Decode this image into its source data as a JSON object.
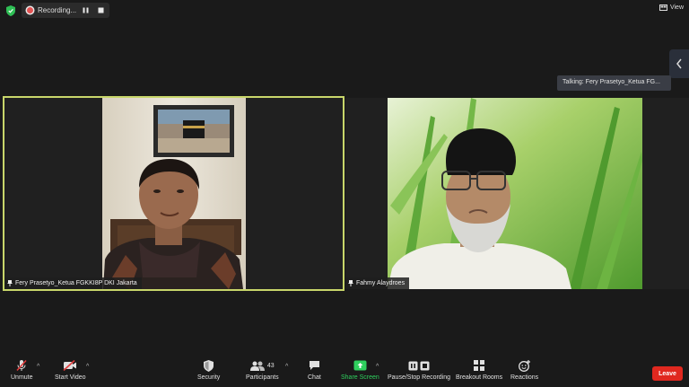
{
  "top": {
    "recording_label": "Recording...",
    "view_label": "View"
  },
  "talking": {
    "text": "Talking: Fery Prasetyo_Ketua FG..."
  },
  "participants_video": [
    {
      "name": "Fery Prasetyo_Ketua FGKKI8P DKI Jakarta",
      "active_speaker": true
    },
    {
      "name": "Fahmy Alaydroes",
      "active_speaker": false
    }
  ],
  "toolbar": {
    "unmute_label": "Unmute",
    "start_video_label": "Start Video",
    "security_label": "Security",
    "participants_label": "Participants",
    "participants_count": "43",
    "chat_label": "Chat",
    "share_screen_label": "Share Screen",
    "pause_stop_recording_label": "Pause/Stop Recording",
    "breakout_rooms_label": "Breakout Rooms",
    "reactions_label": "Reactions",
    "leave_label": "Leave"
  },
  "colors": {
    "background": "#1a1a1a",
    "active_speaker_border": "#c8d66a",
    "share_green": "#2fd05e",
    "leave_red": "#e0281f",
    "recording_red": "#e35353"
  }
}
